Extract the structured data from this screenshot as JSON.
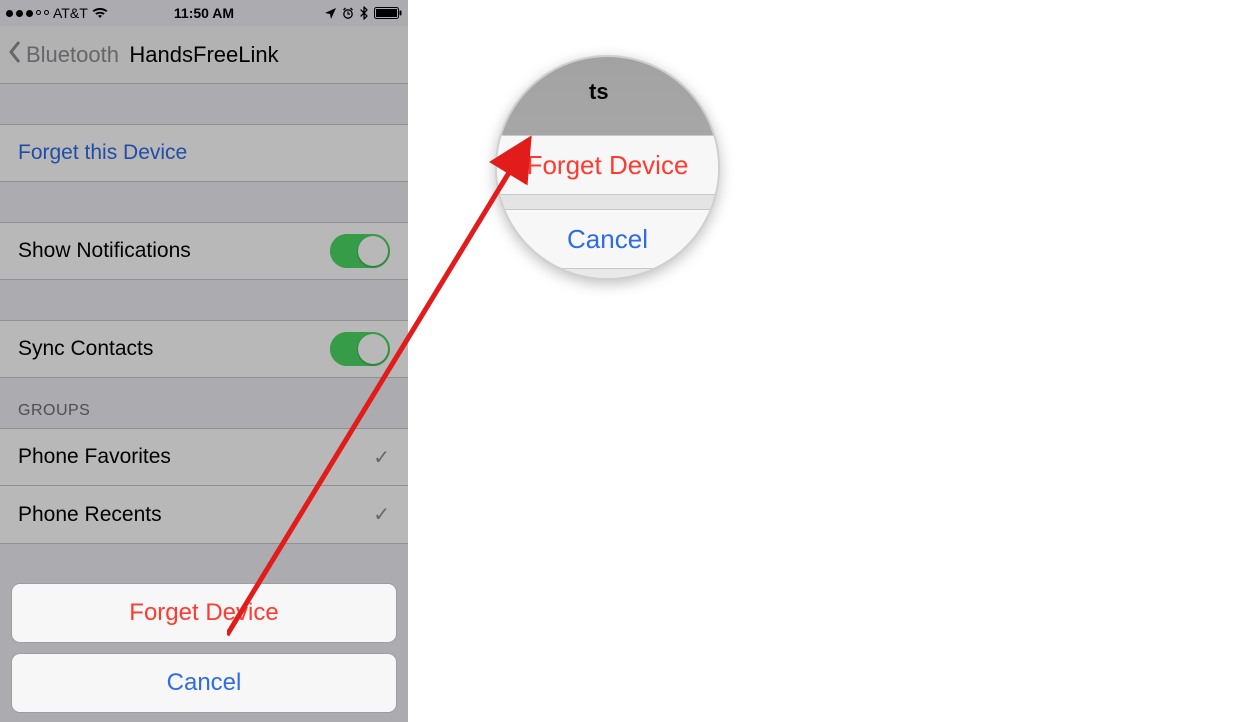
{
  "status": {
    "carrier": "AT&T",
    "time": "11:50 AM"
  },
  "nav": {
    "back_label": "Bluetooth",
    "title": "HandsFreeLink"
  },
  "rows": {
    "forget_this_device": "Forget this Device",
    "show_notifications": "Show Notifications",
    "sync_contacts": "Sync Contacts"
  },
  "groups": {
    "header": "GROUPS",
    "favorites": "Phone Favorites",
    "recents": "Phone Recents"
  },
  "action_sheet": {
    "forget": "Forget Device",
    "cancel": "Cancel"
  },
  "zoom": {
    "hint": "ts",
    "forget": "Forget Device",
    "cancel": "Cancel"
  }
}
